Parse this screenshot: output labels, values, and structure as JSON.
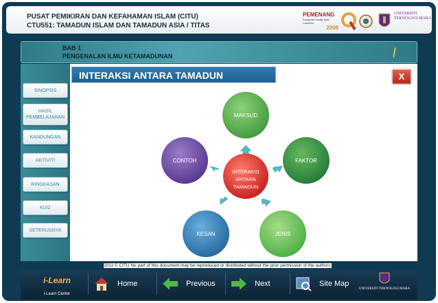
{
  "header": {
    "institution": "PUSAT PEMIKIRAN DAN KEFAHAMAN ISLAM (CITU)",
    "course": "CTU551: TAMADUN ISLAM DAN TAMADUN ASIA / TITAS",
    "award": {
      "line1": "PEMENANG",
      "line2": "Anugerah Kualiti Naib Canselor",
      "year": "2008"
    },
    "university_logo": "UNIVERSITI TEKNOLOGI MARA",
    "icons": [
      "award-badge",
      "quality-q-logo",
      "crest-icon",
      "uitm-crest-icon"
    ]
  },
  "chapter": {
    "number": "BAB 1",
    "title": "PENGENALAN ILMU KETAMADUNAN",
    "slash": "/"
  },
  "sidebar": {
    "items": [
      {
        "label": "SINOPSIS"
      },
      {
        "label": "HASIL PEMBELAJARAN"
      },
      {
        "label": "KANDUNGAN"
      },
      {
        "label": "AKTIVITI"
      },
      {
        "label": "RINGKASAN"
      },
      {
        "label": "KUIZ"
      },
      {
        "label": "SETERUSNYA"
      }
    ]
  },
  "main": {
    "topic_title": "INTERAKSI ANTARA TAMADUN",
    "close_label": "X",
    "diagram": {
      "center": [
        "INTERAKSI",
        "ANTARA",
        "TAMADUN"
      ],
      "nodes": [
        "MAKSUD",
        "FAKTOR",
        "JENIS",
        "KESAN",
        "CONTOH"
      ]
    },
    "colors": {
      "center": "#e0302f",
      "maksud": "#4aa648",
      "faktor": "#2b8a43",
      "jenis": "#56b84a",
      "kesan": "#2f7db3",
      "contoh": "#6b48a0",
      "arrows": "#4aa8b8"
    }
  },
  "footer": {
    "copyright": "2011 © CITU No part of this document may be reproduced or distributed without the prior permission of the authors.",
    "brand": {
      "logo": "i-Learn",
      "caption": "i-Learn Center"
    },
    "buttons": [
      {
        "label": "Home",
        "icon": "home-icon"
      },
      {
        "label": "Previous",
        "icon": "arrow-left-icon"
      },
      {
        "label": "Next",
        "icon": "arrow-right-icon"
      },
      {
        "label": "Site Map",
        "icon": "sitemap-icon"
      }
    ],
    "university": "UNIVERSITI TEKNOLOGI MARA"
  }
}
